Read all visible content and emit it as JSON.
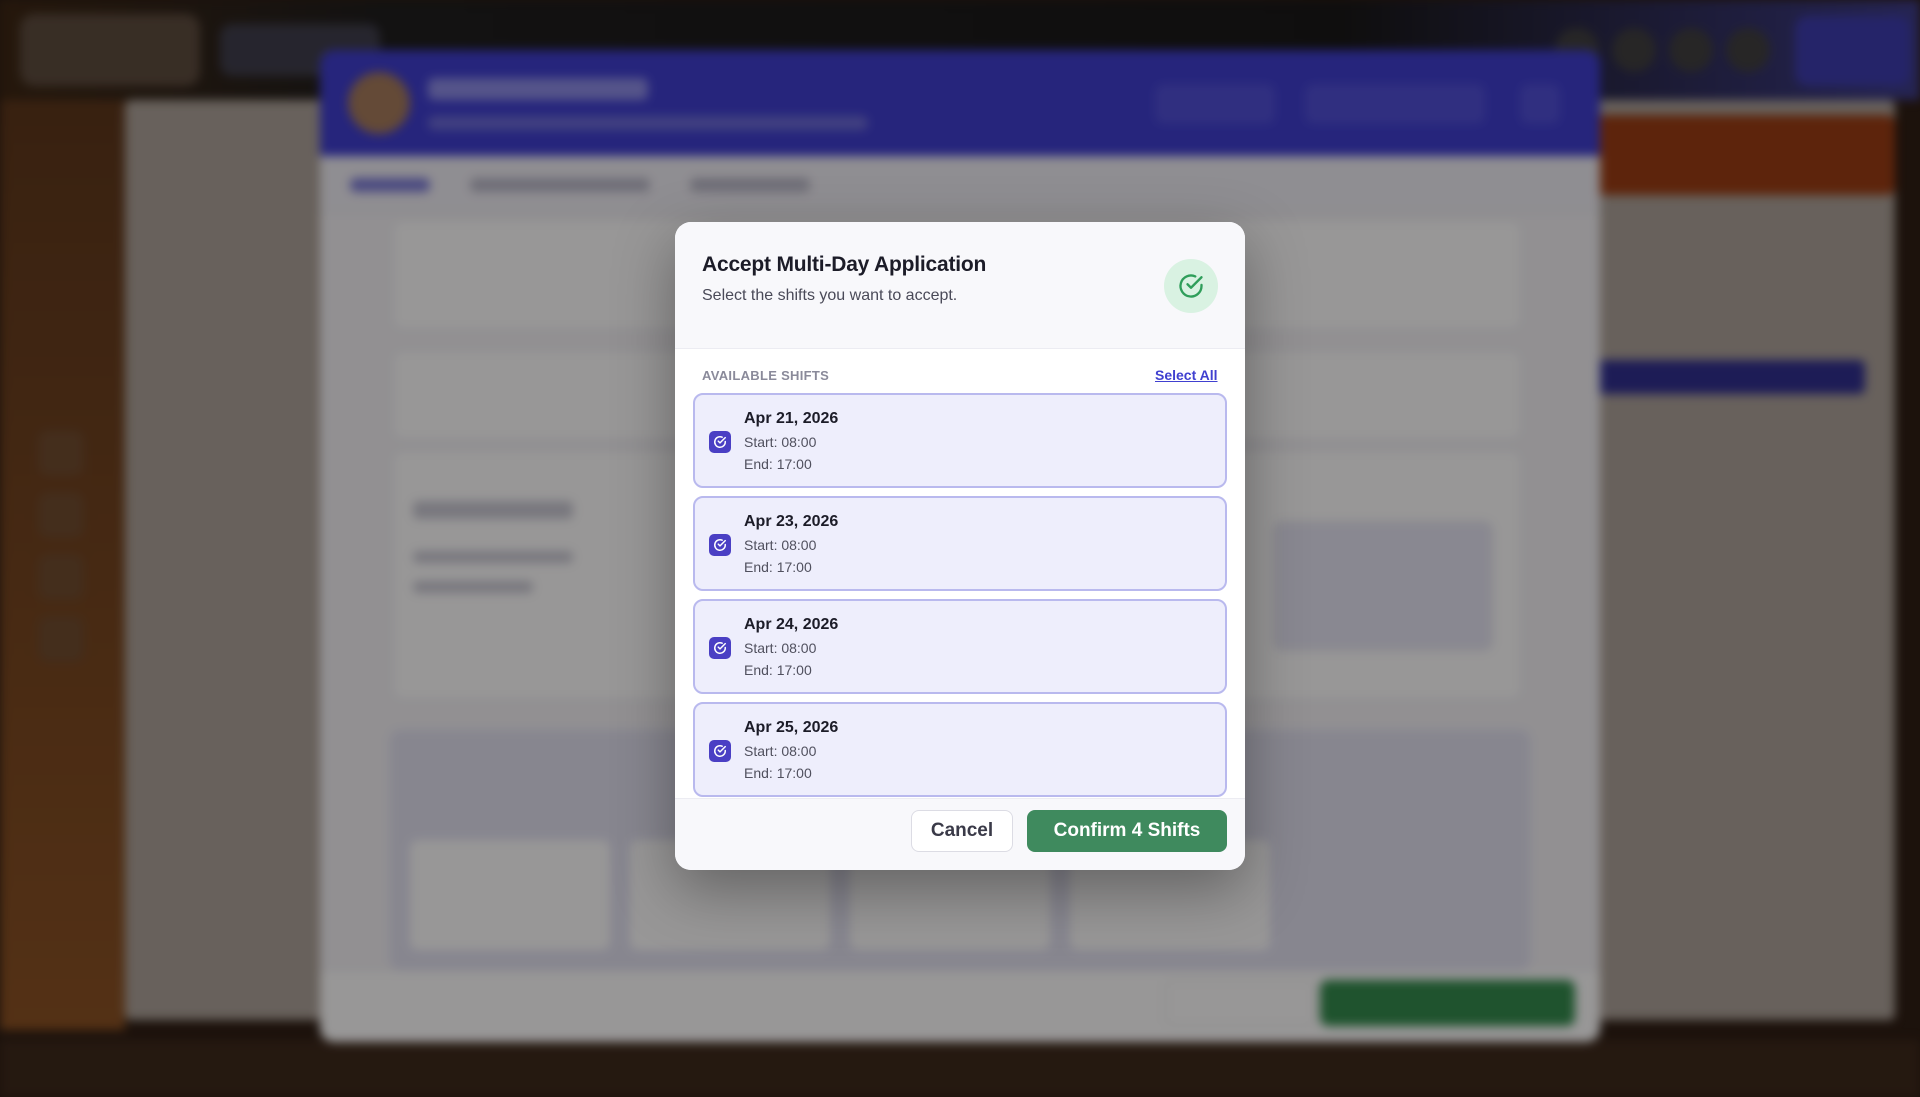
{
  "modal": {
    "title": "Accept Multi-Day Application",
    "subtitle": "Select the shifts you want to accept.",
    "section_label": "AVAILABLE SHIFTS",
    "select_all_label": "Select All",
    "shifts": [
      {
        "date": "Apr 21, 2026",
        "start": "Start: 08:00",
        "end": "End: 17:00",
        "selected": true
      },
      {
        "date": "Apr 23, 2026",
        "start": "Start: 08:00",
        "end": "End: 17:00",
        "selected": true
      },
      {
        "date": "Apr 24, 2026",
        "start": "Start: 08:00",
        "end": "End: 17:00",
        "selected": true
      },
      {
        "date": "Apr 25, 2026",
        "start": "Start: 08:00",
        "end": "End: 17:00",
        "selected": true
      }
    ],
    "cancel_label": "Cancel",
    "confirm_label": "Confirm 4 Shifts",
    "icon": "check-circle-icon"
  },
  "colors": {
    "accent": "#4a3fc4",
    "confirm": "#3f8a5e",
    "badge_bg": "#d9f2e2",
    "card_bg": "#eeeefc"
  }
}
